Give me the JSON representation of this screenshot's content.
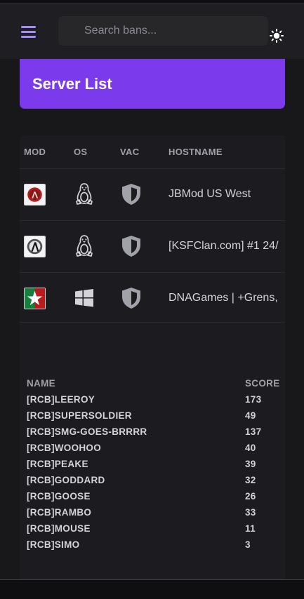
{
  "header": {
    "search_placeholder": "Search bans...",
    "menu_icon": "hamburger-menu-icon",
    "theme_icon": "sun-icon"
  },
  "panel": {
    "title": "Server List"
  },
  "servers": {
    "columns": {
      "mod": "MOD",
      "os": "OS",
      "vac": "VAC",
      "hostname": "HOSTNAME"
    },
    "rows": [
      {
        "mod_icon": "half-life-deathmatch-icon",
        "os_icon": "linux-tux-icon",
        "vac_icon": "vac-shield-icon",
        "hostname": "JBMod US West"
      },
      {
        "mod_icon": "half-life-2-icon",
        "os_icon": "linux-tux-icon",
        "vac_icon": "vac-shield-icon",
        "hostname": "[KSFClan.com] #1 24/"
      },
      {
        "mod_icon": "hl2-deathmatch-icon",
        "os_icon": "windows-icon",
        "vac_icon": "vac-shield-icon",
        "hostname": "DNAGames | +Grens,"
      }
    ]
  },
  "players": {
    "columns": {
      "name": "NAME",
      "score": "SCORE"
    },
    "rows": [
      {
        "name": "[RCB]LEEROY",
        "score": "173"
      },
      {
        "name": "[RCB]SUPERSOLDIER",
        "score": "49"
      },
      {
        "name": "[RCB]SMG-GOES-BRRRR",
        "score": "137"
      },
      {
        "name": "[RCB]WOOHOO",
        "score": "40"
      },
      {
        "name": "[RCB]PEAKE",
        "score": "39"
      },
      {
        "name": "[RCB]GODDARD",
        "score": "32"
      },
      {
        "name": "[RCB]GOOSE",
        "score": "26"
      },
      {
        "name": "[RCB]RAMBO",
        "score": "33"
      },
      {
        "name": "[RCB]MOUSE",
        "score": "11"
      },
      {
        "name": "[RCB]SIMO",
        "score": "3"
      }
    ]
  },
  "colors": {
    "accent": "#7c3aed",
    "menu": "#a78bfa",
    "background": "#18181b"
  }
}
